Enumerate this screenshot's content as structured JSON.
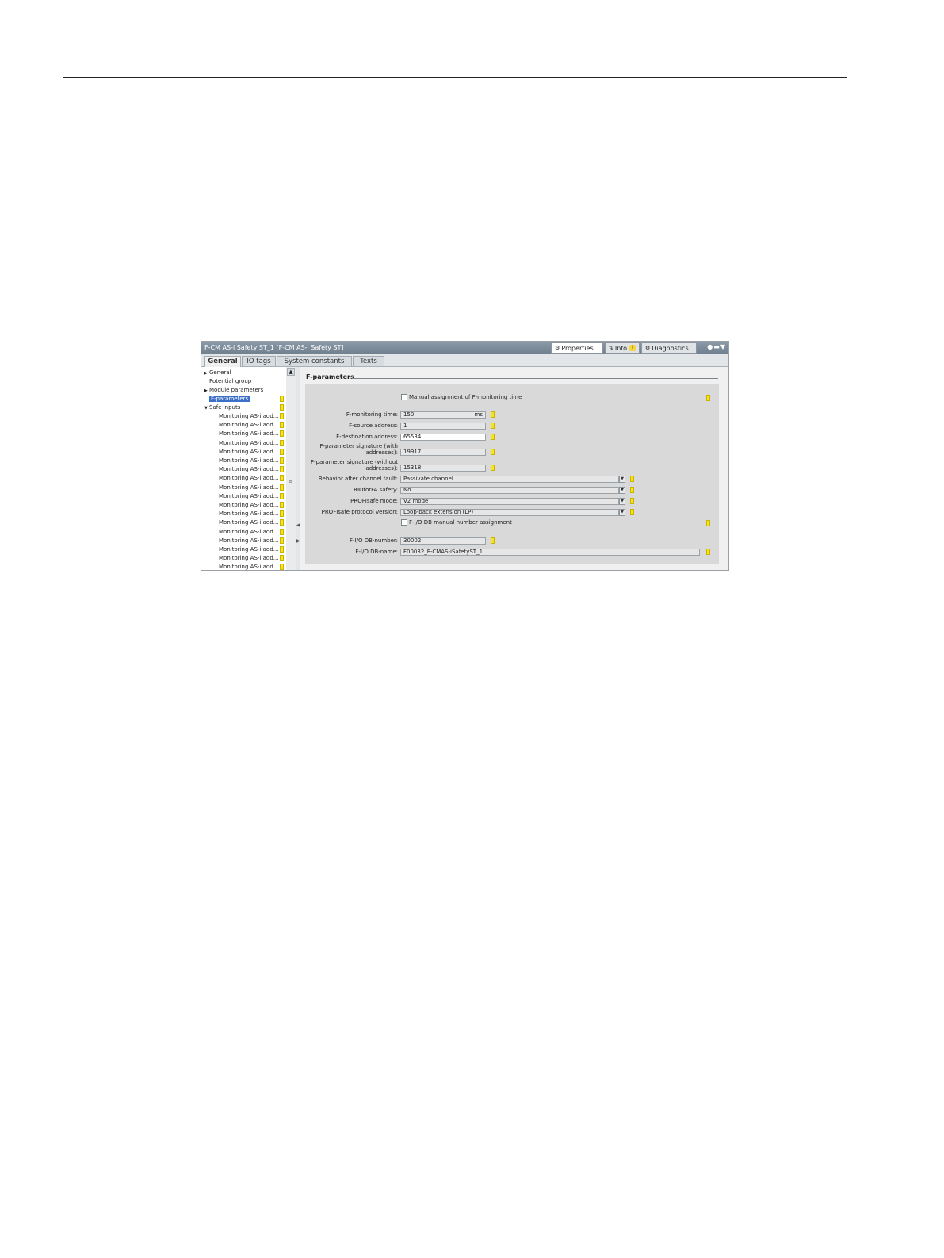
{
  "window": {
    "title": "F-CM AS-i Safety ST_1 [F-CM AS-i Safety ST]",
    "panel_tabs": [
      {
        "label": "Properties"
      },
      {
        "label": "Info"
      },
      {
        "label": "Diagnostics"
      }
    ],
    "info_badge": "i"
  },
  "tabs": [
    {
      "label": "General",
      "active": true
    },
    {
      "label": "IO tags"
    },
    {
      "label": "System constants"
    },
    {
      "label": "Texts"
    }
  ],
  "nav": {
    "items": [
      {
        "label": "General"
      },
      {
        "label": "Potential group"
      },
      {
        "label": "Module parameters"
      },
      {
        "label": "F-parameters",
        "selected": true
      },
      {
        "label": "Safe inputs"
      }
    ],
    "monitoring_label": "Monitoring AS-i add...",
    "monitoring_count": 19
  },
  "section": {
    "title": "F-parameters"
  },
  "form": {
    "manual_monitoring_label": "Manual assignment of F-monitoring time",
    "fmon_label": "F-monitoring time:",
    "fmon_value": "150",
    "fmon_unit": "ms",
    "fsrc_label": "F-source address:",
    "fsrc_value": "1",
    "fdest_label": "F-destination address:",
    "fdest_value": "65534",
    "sig_with_label_1": "F-parameter signature (with",
    "sig_with_label_2": "addresses):",
    "sig_with_value": "19917",
    "sig_without_label_1": "F-parameter signature (without",
    "sig_without_label_2": "addresses):",
    "sig_without_value": "15318",
    "behavior_label": "Behavior after channel fault:",
    "behavior_value": "Passivate channel",
    "riofor_label": "RIOforFA safety:",
    "riofor_value": "No",
    "profisafe_mode_label": "PROFIsafe mode:",
    "profisafe_mode_value": "V2 mode",
    "profisafe_proto_label": "PROFIsafe protocol version:",
    "profisafe_proto_value": "Loop-back extension (LP)",
    "db_manual_label": "F-I/O DB manual number assignment",
    "db_number_label": "F-I/O DB-number:",
    "db_number_value": "30002",
    "db_name_label": "F-I/O DB-name:",
    "db_name_value": "F00032_F-CMAS-iSafetyST_1"
  },
  "colors": {
    "marker": "#f7e31c",
    "selection": "#3b6fc8",
    "titlebar": "#7a8a98"
  }
}
